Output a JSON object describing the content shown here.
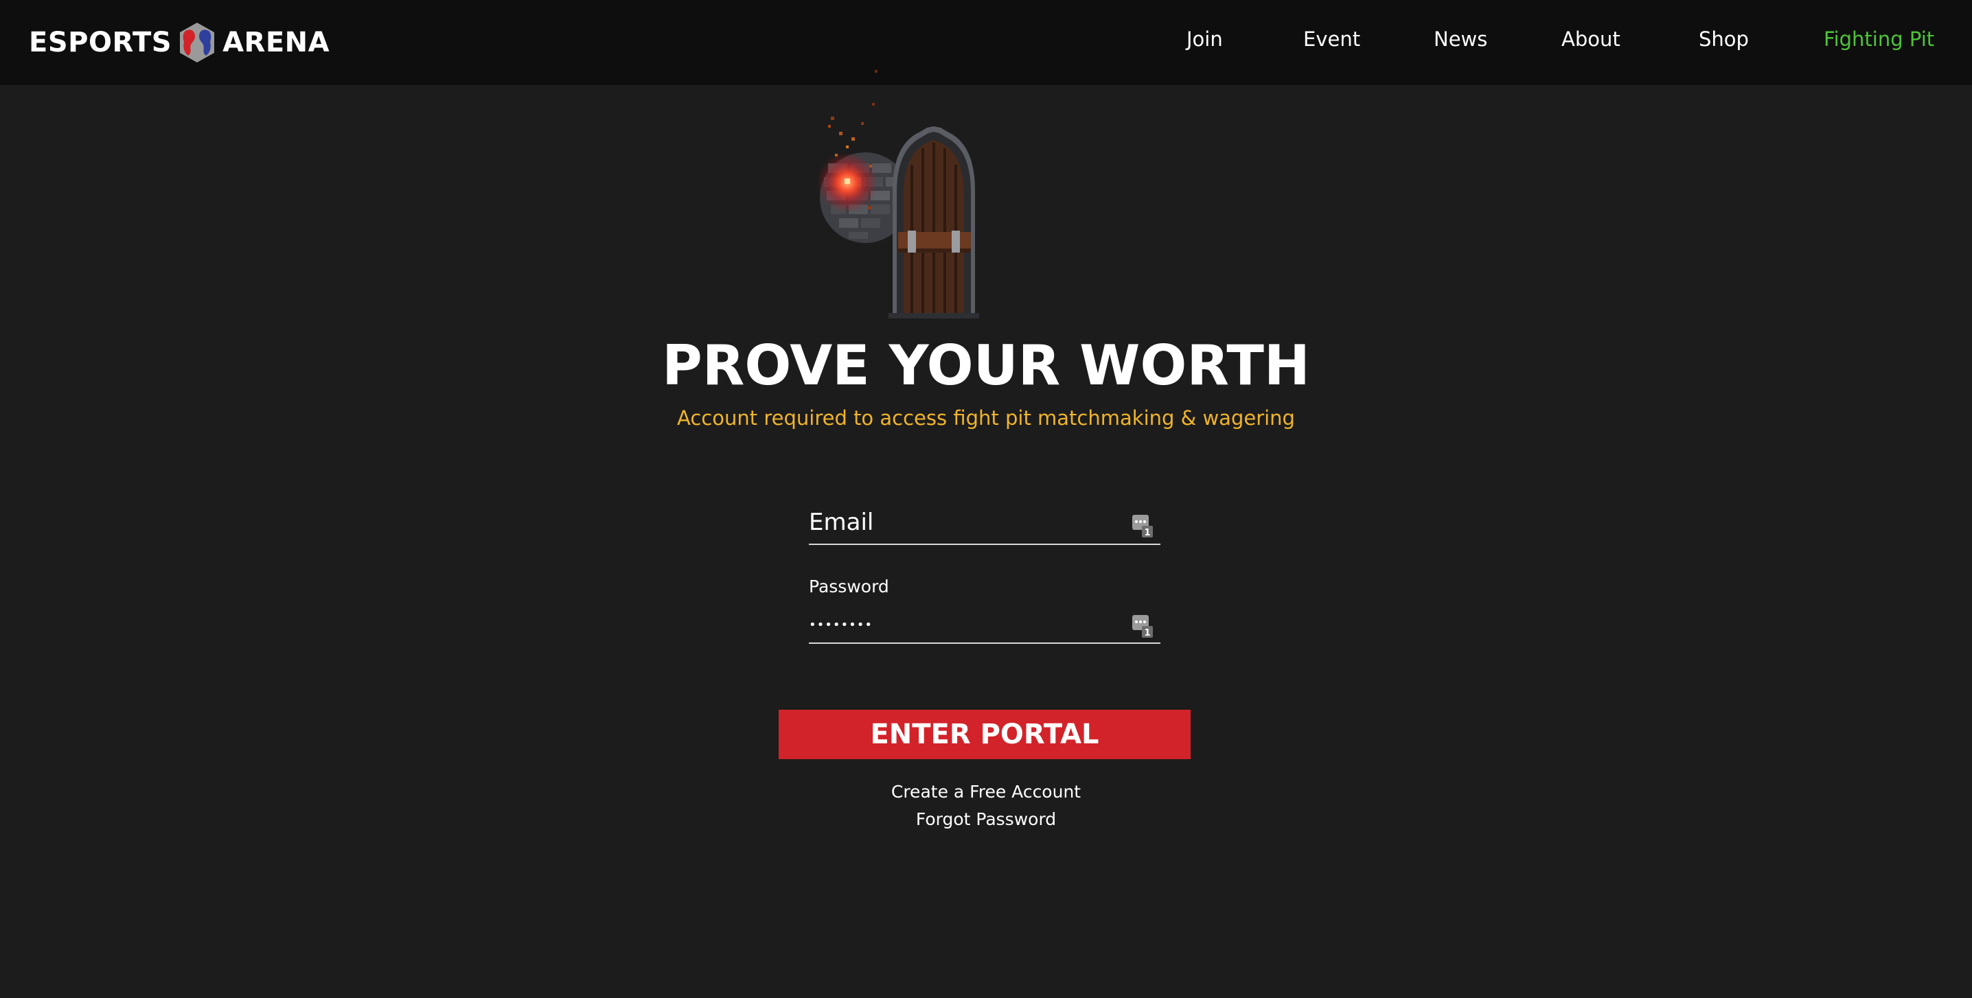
{
  "header": {
    "logo_left": "ESPORTS",
    "logo_right": "ARENA",
    "nav": [
      {
        "label": "Join"
      },
      {
        "label": "Event"
      },
      {
        "label": "News"
      },
      {
        "label": "About"
      },
      {
        "label": "Shop"
      },
      {
        "label": "Fighting Pit",
        "active": true
      }
    ]
  },
  "hero": {
    "title": "PROVE YOUR WORTH",
    "subtitle": "Account required to access fight pit matchmaking & wagering"
  },
  "form": {
    "email": {
      "placeholder": "Email",
      "value": ""
    },
    "password": {
      "label": "Password",
      "value": "••••••••"
    },
    "submit_label": "ENTER PORTAL"
  },
  "links": {
    "create_account": "Create a Free Account",
    "forgot_password": "Forgot Password"
  },
  "colors": {
    "background": "#1c1c1c",
    "header_bg": "#0e0e0e",
    "accent_red": "#d2232a",
    "subtitle_gold": "#f0b42a",
    "active_nav_green": "#4ec439"
  },
  "icons": [
    "logo-emblem-icon",
    "door-icon",
    "torch-icon",
    "password-manager-icon"
  ]
}
